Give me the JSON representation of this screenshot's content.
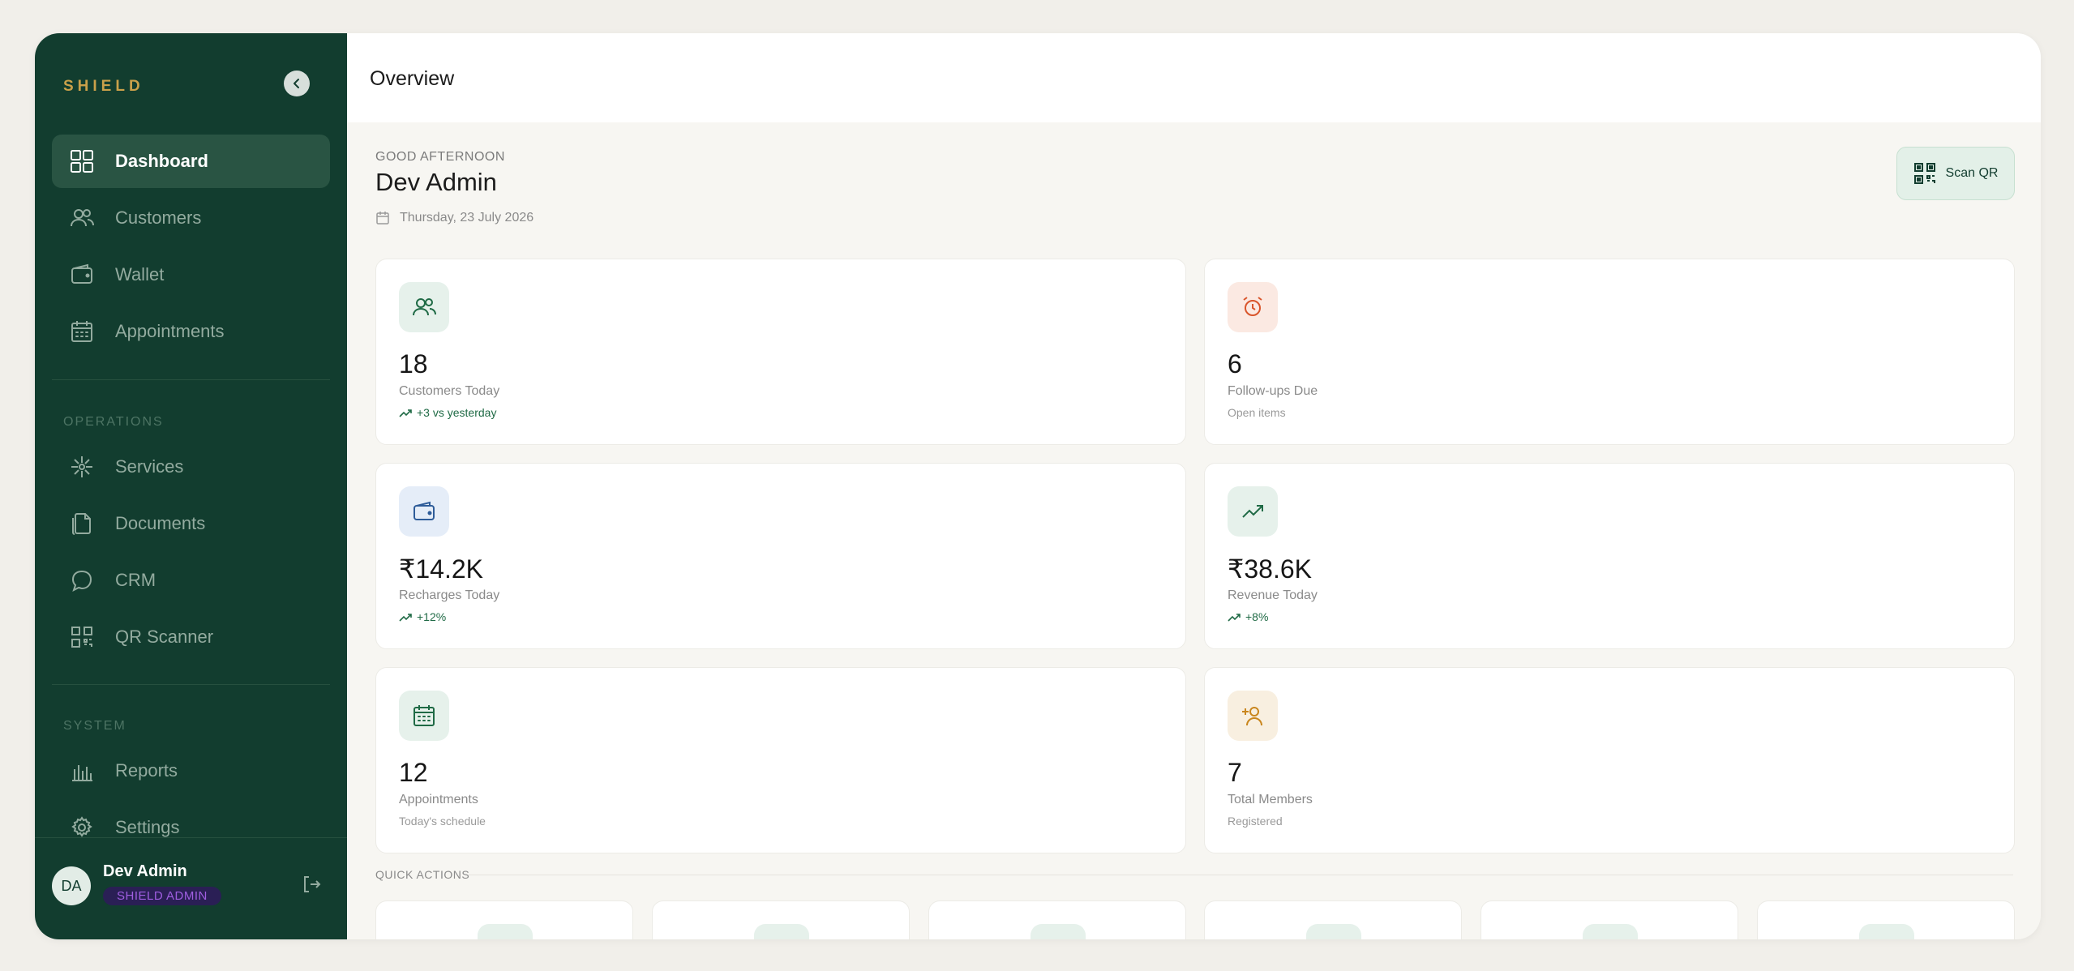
{
  "sidebar": {
    "brand": "SHIELD",
    "primary": [
      {
        "label": "Dashboard",
        "icon": "grid-icon",
        "active": true
      },
      {
        "label": "Customers",
        "icon": "users-icon"
      },
      {
        "label": "Wallet",
        "icon": "wallet-icon"
      },
      {
        "label": "Appointments",
        "icon": "calendar-icon"
      }
    ],
    "operations_label": "OPERATIONS",
    "operations": [
      {
        "label": "Services",
        "icon": "flower-icon"
      },
      {
        "label": "Documents",
        "icon": "documents-icon"
      },
      {
        "label": "CRM",
        "icon": "chat-icon"
      },
      {
        "label": "QR Scanner",
        "icon": "qr-icon"
      }
    ],
    "system_label": "SYSTEM",
    "system": [
      {
        "label": "Reports",
        "icon": "bar-chart-icon"
      },
      {
        "label": "Settings",
        "icon": "gear-icon"
      }
    ],
    "user": {
      "initials": "DA",
      "name": "Dev Admin",
      "role": "SHIELD ADMIN"
    }
  },
  "header": {
    "title": "Overview"
  },
  "welcome": {
    "greeting": "GOOD AFTERNOON",
    "name": "Dev Admin",
    "date": "Thursday, 23 July 2026",
    "scan_button": "Scan QR"
  },
  "stats": [
    {
      "value": "18",
      "label": "Customers Today",
      "sub": "+3 vs yesterday",
      "icon": "users-icon",
      "trend": true
    },
    {
      "value": "6",
      "label": "Follow-ups Due",
      "sub": "Open items",
      "icon": "alarm-clock-icon",
      "trend": false
    },
    {
      "value": "₹14.2K",
      "label": "Recharges Today",
      "sub": "+12%",
      "icon": "wallet-icon",
      "trend": true
    },
    {
      "value": "₹38.6K",
      "label": "Revenue Today",
      "sub": "+8%",
      "icon": "trending-up-icon",
      "trend": true
    },
    {
      "value": "12",
      "label": "Appointments",
      "sub": "Today's schedule",
      "icon": "calendar-icon",
      "trend": false
    },
    {
      "value": "7",
      "label": "Total Members",
      "sub": "Registered",
      "icon": "user-plus-icon",
      "trend": false
    }
  ],
  "quick_actions": {
    "label": "QUICK ACTIONS"
  },
  "colors": {
    "sidebar": "#123d2f",
    "accent": "#c9a04a",
    "trend": "#1f6a45"
  }
}
